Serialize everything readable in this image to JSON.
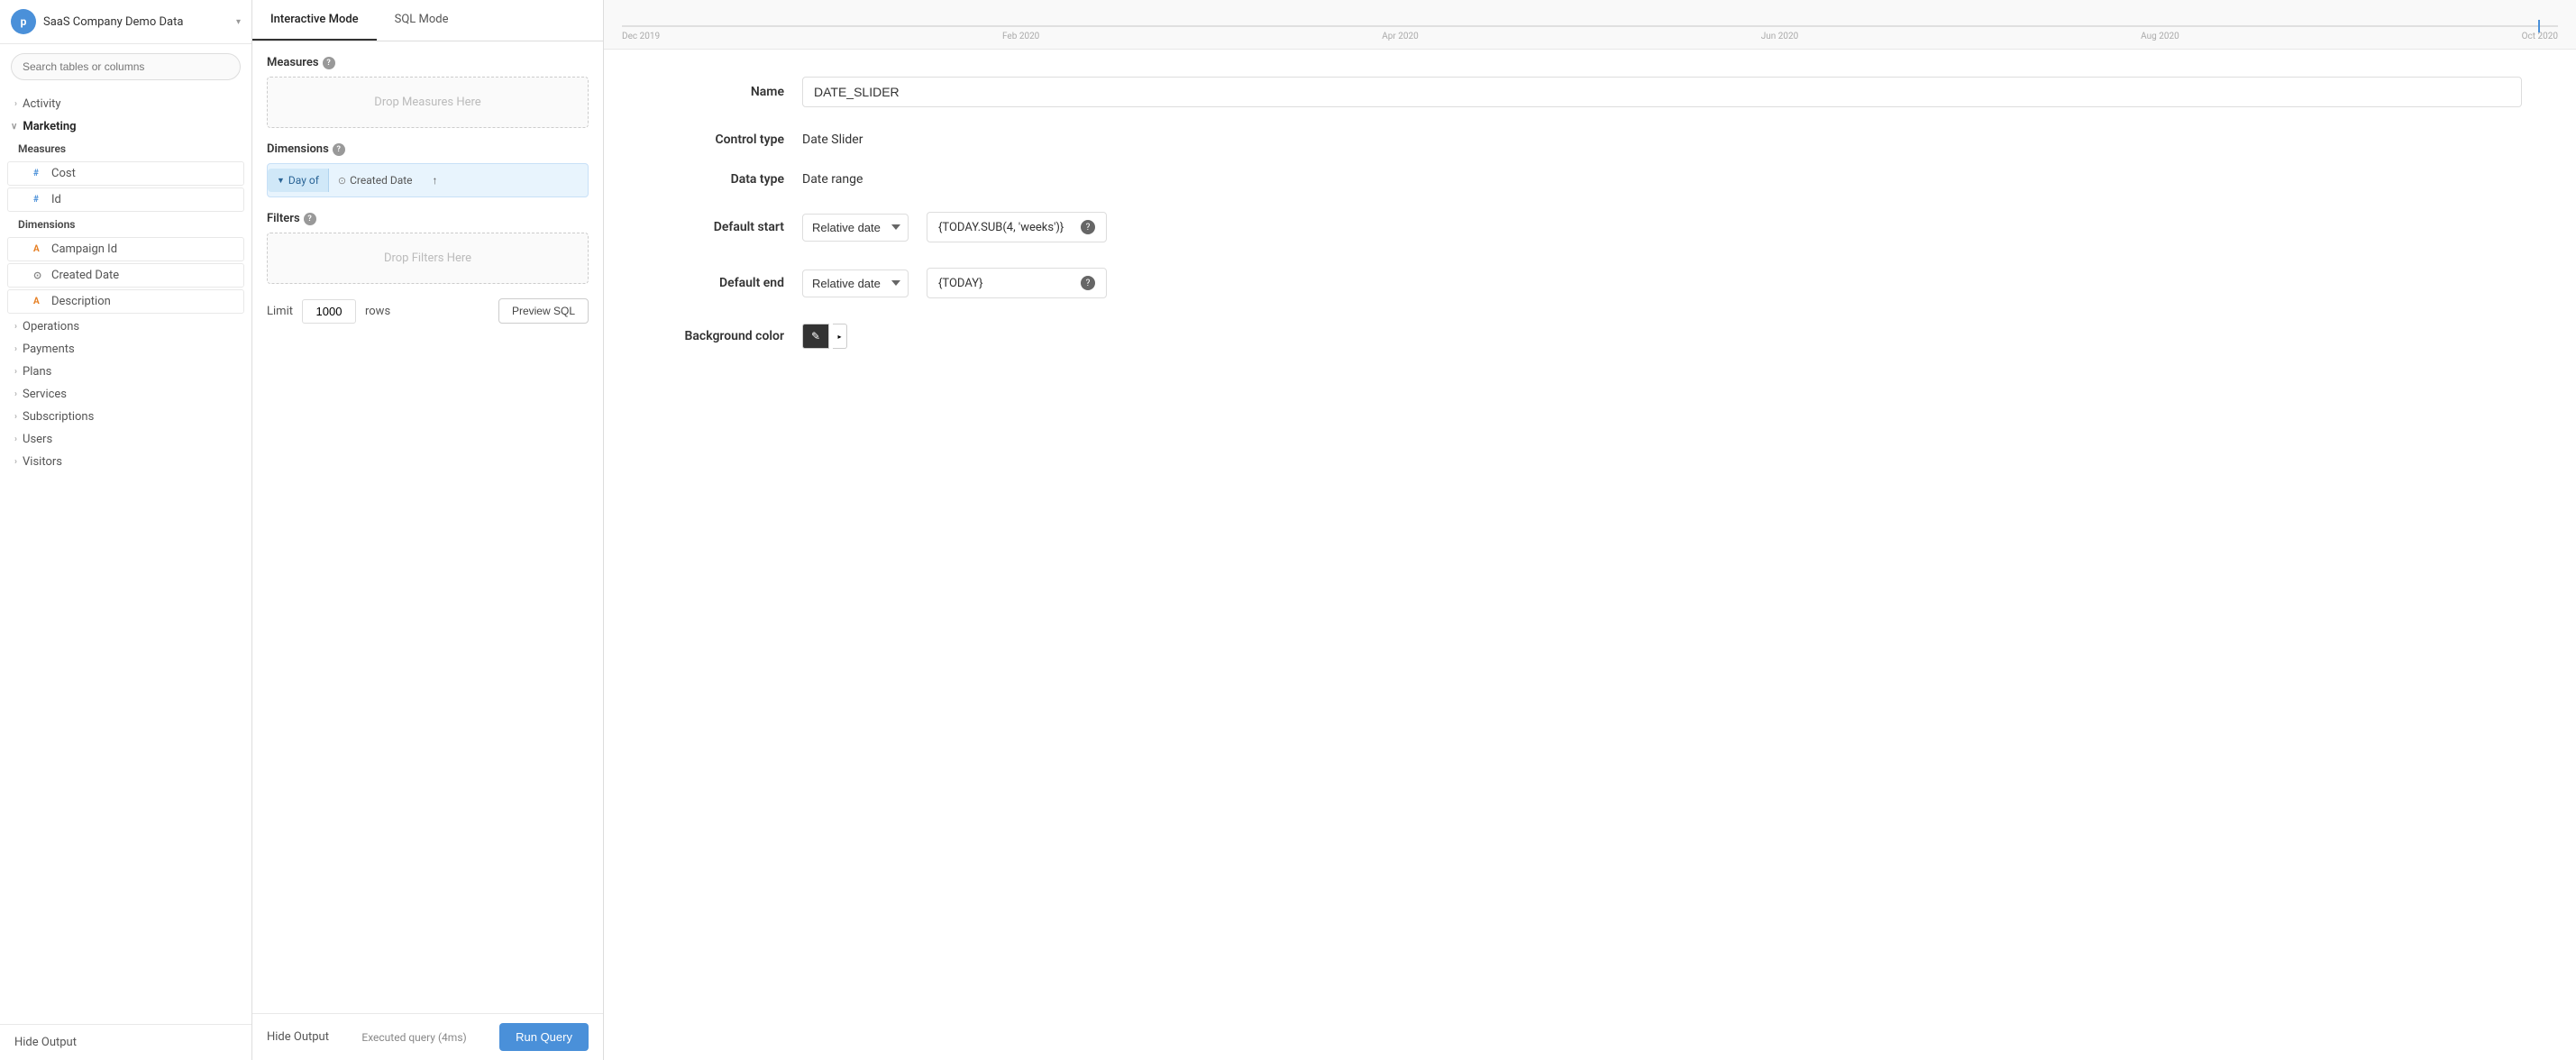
{
  "app": {
    "db_name": "SaaS Company Demo Data",
    "logo_text": "p"
  },
  "sidebar": {
    "search_placeholder": "Search tables or columns",
    "items": [
      {
        "label": "Activity",
        "type": "collapsed",
        "icon": "chevron-right"
      },
      {
        "label": "Marketing",
        "type": "expanded",
        "icon": "chevron-down"
      },
      {
        "label": "Measures",
        "type": "sub-section"
      },
      {
        "label": "Cost",
        "type": "leaf",
        "badge": "#"
      },
      {
        "label": "Id",
        "type": "leaf",
        "badge": "#"
      },
      {
        "label": "Dimensions",
        "type": "sub-section"
      },
      {
        "label": "Campaign Id",
        "type": "leaf",
        "badge": "A"
      },
      {
        "label": "Created Date",
        "type": "leaf",
        "badge": "clock"
      },
      {
        "label": "Description",
        "type": "leaf",
        "badge": "A"
      },
      {
        "label": "Operations",
        "type": "collapsed",
        "icon": "chevron-right"
      },
      {
        "label": "Payments",
        "type": "collapsed",
        "icon": "chevron-right"
      },
      {
        "label": "Plans",
        "type": "collapsed",
        "icon": "chevron-right"
      },
      {
        "label": "Services",
        "type": "collapsed",
        "icon": "chevron-right"
      },
      {
        "label": "Subscriptions",
        "type": "collapsed",
        "icon": "chevron-right"
      },
      {
        "label": "Users",
        "type": "collapsed",
        "icon": "chevron-right"
      },
      {
        "label": "Visitors",
        "type": "collapsed",
        "icon": "chevron-right"
      }
    ],
    "hide_output_label": "Hide Output"
  },
  "middle": {
    "tabs": [
      {
        "label": "Interactive Mode",
        "active": true
      },
      {
        "label": "SQL Mode",
        "active": false
      }
    ],
    "measures_label": "Measures",
    "measures_drop_hint": "Drop Measures Here",
    "dimensions_label": "Dimensions",
    "dimension_chip1": "Day of",
    "dimension_chip2": "Created Date",
    "filters_label": "Filters",
    "filters_drop_hint": "Drop Filters Here",
    "limit_label": "Limit",
    "limit_value": "1000",
    "rows_label": "rows",
    "preview_sql_label": "Preview SQL",
    "executed_text": "Executed query (4ms)",
    "run_query_label": "Run Query"
  },
  "right": {
    "timeline": {
      "labels": [
        "Dec 2019",
        "Feb 2020",
        "Apr 2020",
        "Jun 2020",
        "Aug 2020",
        "Oct 2020"
      ]
    },
    "form": {
      "name_label": "Name",
      "name_value": "DATE_SLIDER",
      "control_type_label": "Control type",
      "control_type_value": "Date Slider",
      "data_type_label": "Data type",
      "data_type_value": "Date range",
      "default_start_label": "Default start",
      "default_start_select": "Relative date",
      "default_start_input": "{TODAY.SUB(4, 'weeks')}",
      "default_end_label": "Default end",
      "default_end_select": "Relative date",
      "default_end_input": "{TODAY}",
      "bg_color_label": "Background color"
    }
  }
}
